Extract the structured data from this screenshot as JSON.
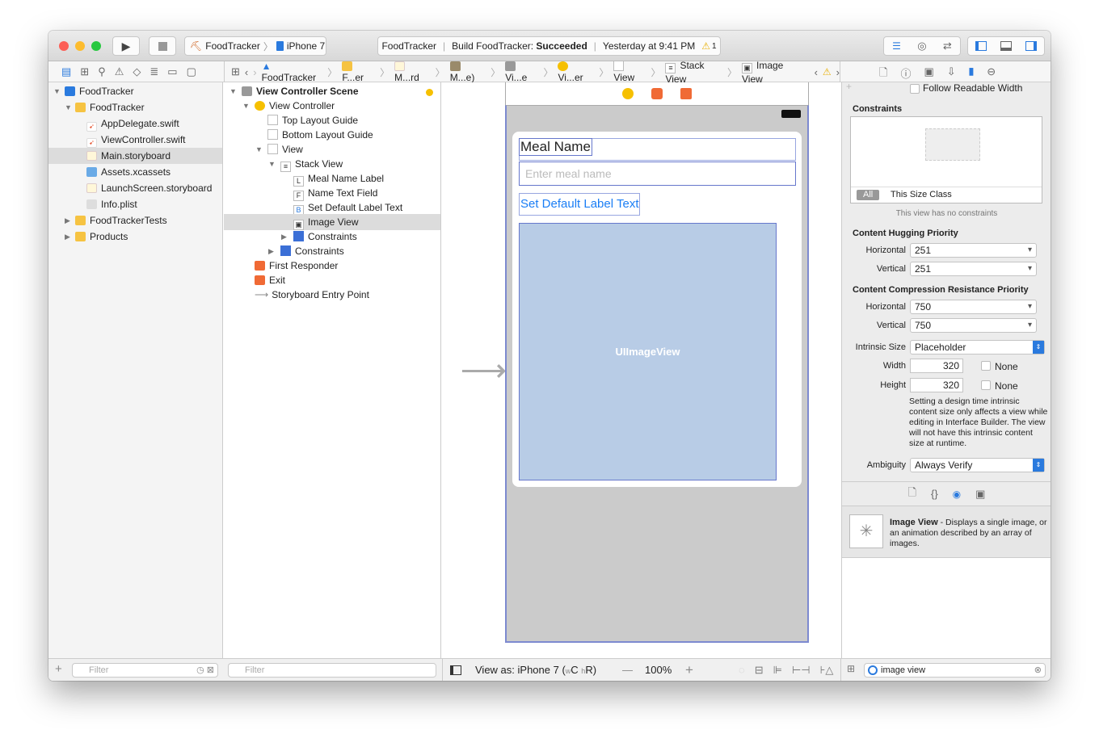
{
  "toolbar": {
    "scheme": "FoodTracker",
    "device": "iPhone 7",
    "status_project": "FoodTracker",
    "status_build": "Build FoodTracker:",
    "status_result": "Succeeded",
    "status_time": "Yesterday at 9:41 PM",
    "warning_count": "1"
  },
  "jumpbar": [
    "FoodTracker",
    "F...er",
    "M...rd",
    "M...e)",
    "Vi...e",
    "Vi...er",
    "View",
    "Stack View",
    "Image View"
  ],
  "navigator": {
    "items": [
      {
        "label": "FoodTracker",
        "type": "project"
      },
      {
        "label": "FoodTracker",
        "type": "folder"
      },
      {
        "label": "AppDelegate.swift",
        "type": "swift"
      },
      {
        "label": "ViewController.swift",
        "type": "swift"
      },
      {
        "label": "Main.storyboard",
        "type": "storyboard",
        "selected": true
      },
      {
        "label": "Assets.xcassets",
        "type": "assets"
      },
      {
        "label": "LaunchScreen.storyboard",
        "type": "storyboard"
      },
      {
        "label": "Info.plist",
        "type": "plist"
      },
      {
        "label": "FoodTrackerTests",
        "type": "folder"
      },
      {
        "label": "Products",
        "type": "folder"
      }
    ],
    "filter_placeholder": "Filter"
  },
  "outline": {
    "items": [
      {
        "label": "View Controller Scene",
        "badge": "L"
      },
      {
        "label": "View Controller"
      },
      {
        "label": "Top Layout Guide"
      },
      {
        "label": "Bottom Layout Guide"
      },
      {
        "label": "View"
      },
      {
        "label": "Stack View"
      },
      {
        "label": "Meal Name Label",
        "badge": "L"
      },
      {
        "label": "Name Text Field",
        "badge": "F"
      },
      {
        "label": "Set Default Label Text",
        "badge": "B"
      },
      {
        "label": "Image View",
        "selected": true
      },
      {
        "label": "Constraints"
      },
      {
        "label": "Constraints"
      },
      {
        "label": "First Responder"
      },
      {
        "label": "Exit"
      },
      {
        "label": "Storyboard Entry Point"
      }
    ],
    "filter_placeholder": "Filter"
  },
  "canvas": {
    "meal_name_label": "Meal Name",
    "text_field_placeholder": "Enter meal name",
    "button_label": "Set Default Label Text",
    "image_view_label": "UIImageView",
    "view_as": "View as: iPhone 7 (",
    "size_w": "w",
    "size_c": "C",
    "size_h": "h",
    "size_r": "R)",
    "zoom": "100%",
    "image_fill": "#b8cce6"
  },
  "inspector": {
    "follow_readable": "Follow Readable Width",
    "constraints_header": "Constraints",
    "all": "All",
    "this_size_class": "This Size Class",
    "no_constraints": "This view has no constraints",
    "hugging_header": "Content Hugging Priority",
    "horizontal": "Horizontal",
    "vertical": "Vertical",
    "hug_h": "251",
    "hug_v": "251",
    "compression_header": "Content Compression Resistance Priority",
    "comp_h": "750",
    "comp_v": "750",
    "intrinsic_label": "Intrinsic Size",
    "intrinsic_value": "Placeholder",
    "width_label": "Width",
    "width_value": "320",
    "height_label": "Height",
    "height_value": "320",
    "none": "None",
    "note": "Setting a design time intrinsic content size only affects a view while editing in Interface Builder. The view will not have this intrinsic content size at runtime.",
    "ambiguity_label": "Ambiguity",
    "ambiguity_value": "Always Verify",
    "library_title": "Image View",
    "library_desc": " - Displays a single image, or an animation described by an array of images.",
    "search_value": "image view"
  }
}
